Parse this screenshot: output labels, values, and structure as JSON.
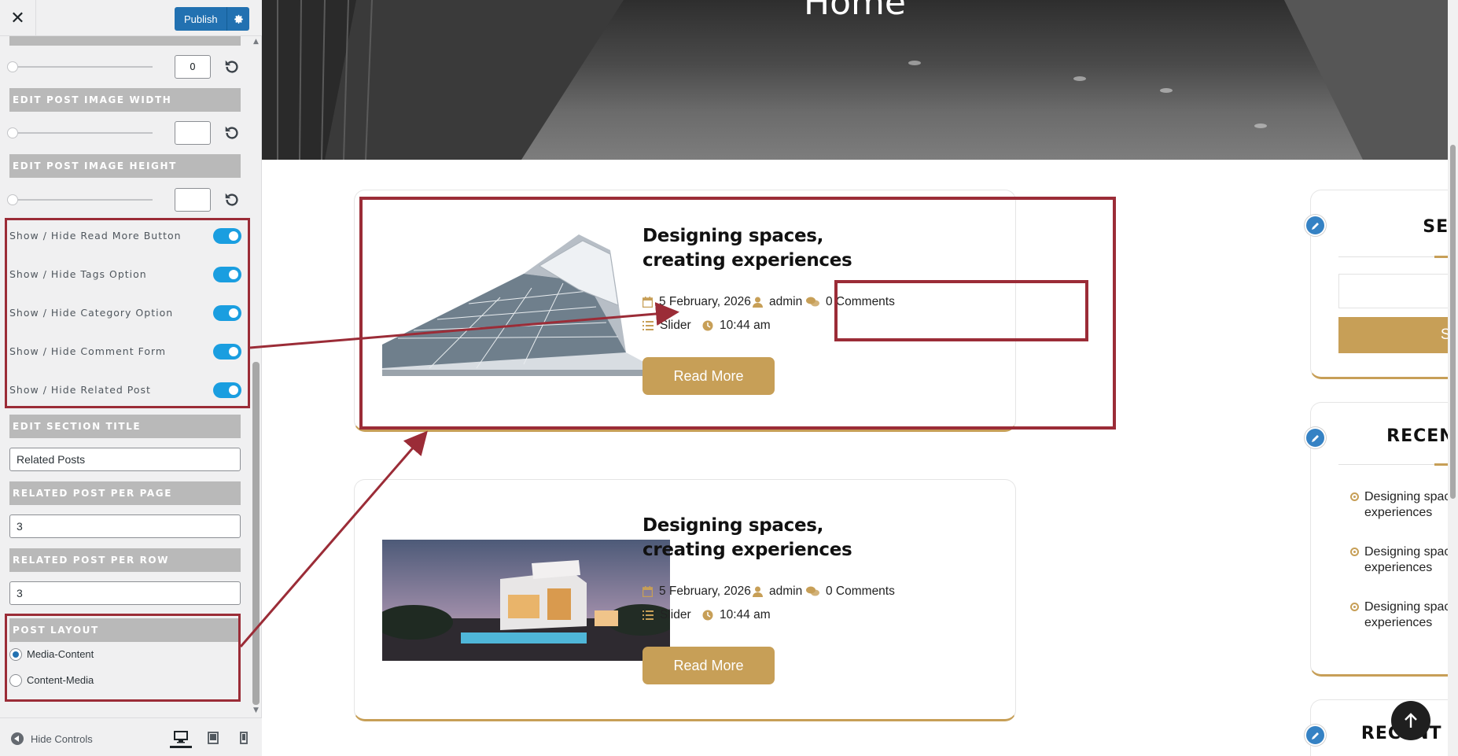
{
  "topbar": {
    "close_icon": "close-icon",
    "publish_label": "Publish",
    "gear_icon": "gear-icon"
  },
  "panel": {
    "sliders": [
      {
        "value": "0"
      },
      {
        "header": "EDIT POST IMAGE WIDTH",
        "value": ""
      },
      {
        "header": "EDIT POST IMAGE HEIGHT",
        "value": ""
      }
    ],
    "toggles": [
      {
        "label": "Show / Hide Read More Button",
        "on": true
      },
      {
        "label": "Show / Hide Tags Option",
        "on": true
      },
      {
        "label": "Show / Hide Category Option",
        "on": true
      },
      {
        "label": "Show / Hide Comment Form",
        "on": true
      },
      {
        "label": "Show / Hide Related Post",
        "on": true
      }
    ],
    "section_title": {
      "header": "EDIT SECTION TITLE",
      "value": "Related Posts"
    },
    "per_page": {
      "header": "RELATED POST PER PAGE",
      "value": "3"
    },
    "per_row": {
      "header": "RELATED POST PER ROW",
      "value": "3"
    },
    "layout": {
      "header": "POST LAYOUT",
      "options": [
        {
          "label": "Media-Content",
          "checked": true
        },
        {
          "label": "Content-Media",
          "checked": false
        }
      ]
    }
  },
  "footer": {
    "hide_controls": "Hide Controls",
    "devices": [
      "desktop",
      "tablet",
      "mobile"
    ]
  },
  "preview": {
    "hero_title": "Home",
    "posts": [
      {
        "title": "Designing spaces, creating experiences",
        "date": "5 February, 2026",
        "author": "admin",
        "comments": "0 Comments",
        "category": "Slider",
        "time": "10:44 am",
        "read_more": "Read More"
      },
      {
        "title": "Designing spaces, creating experiences",
        "date": "5 February, 2026",
        "author": "admin",
        "comments": "0 Comments",
        "category": "Slider",
        "time": "10:44 am",
        "read_more": "Read More"
      }
    ],
    "widgets": {
      "search": {
        "title": "SEARCH",
        "button": "Search",
        "placeholder": ""
      },
      "recent_posts": {
        "title": "RECENT POSTS",
        "items": [
          "Designing spaces, creating experiences",
          "Designing spaces, creating experiences",
          "Designing spaces, creating experiences"
        ]
      },
      "recent_comments": {
        "title": "RECENT COMMENTS"
      }
    }
  },
  "colors": {
    "accent": "#c79f57",
    "wp_blue": "#2271b1",
    "toggle_on": "#1a9ee0",
    "highlight": "#9b2c37"
  }
}
